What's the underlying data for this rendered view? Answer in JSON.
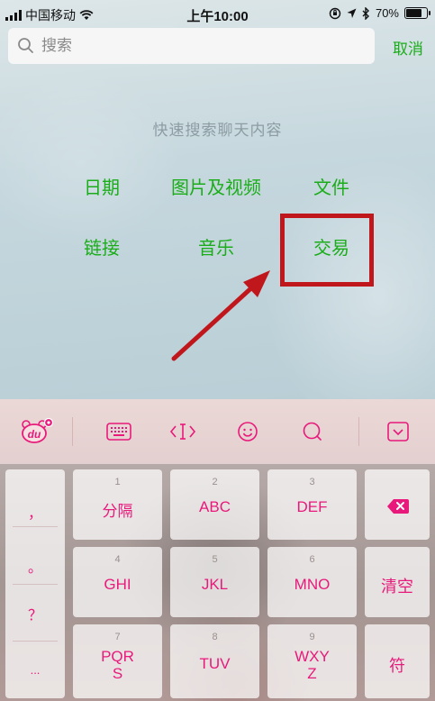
{
  "status_bar": {
    "carrier": "中国移动",
    "time": "上午10:00",
    "battery": "70%",
    "battery_level": 0.7
  },
  "search": {
    "placeholder": "搜索",
    "cancel_label": "取消"
  },
  "quick_search": {
    "hint": "快速搜索聊天内容",
    "categories": [
      "日期",
      "图片及视频",
      "文件",
      "链接",
      "音乐",
      "交易"
    ]
  },
  "keyboard": {
    "side_symbols": [
      "，",
      "。",
      "？",
      "..."
    ],
    "keys": [
      {
        "num": "1",
        "label": "分隔"
      },
      {
        "num": "2",
        "label": "ABC"
      },
      {
        "num": "3",
        "label": "DEF"
      },
      {
        "num": "4",
        "label": "GHI"
      },
      {
        "num": "5",
        "label": "JKL"
      },
      {
        "num": "6",
        "label": "MNO"
      },
      {
        "num": "7",
        "label": "PQR\nS"
      },
      {
        "num": "8",
        "label": "TUV"
      },
      {
        "num": "9",
        "label": "WXY\nZ"
      }
    ],
    "clear_label": "清空",
    "symbol_label": "符",
    "logo_text": "du"
  },
  "colors": {
    "accent_green": "#1aad19",
    "highlight_red": "#c0171d",
    "key_text_pink": "#e8197a"
  }
}
